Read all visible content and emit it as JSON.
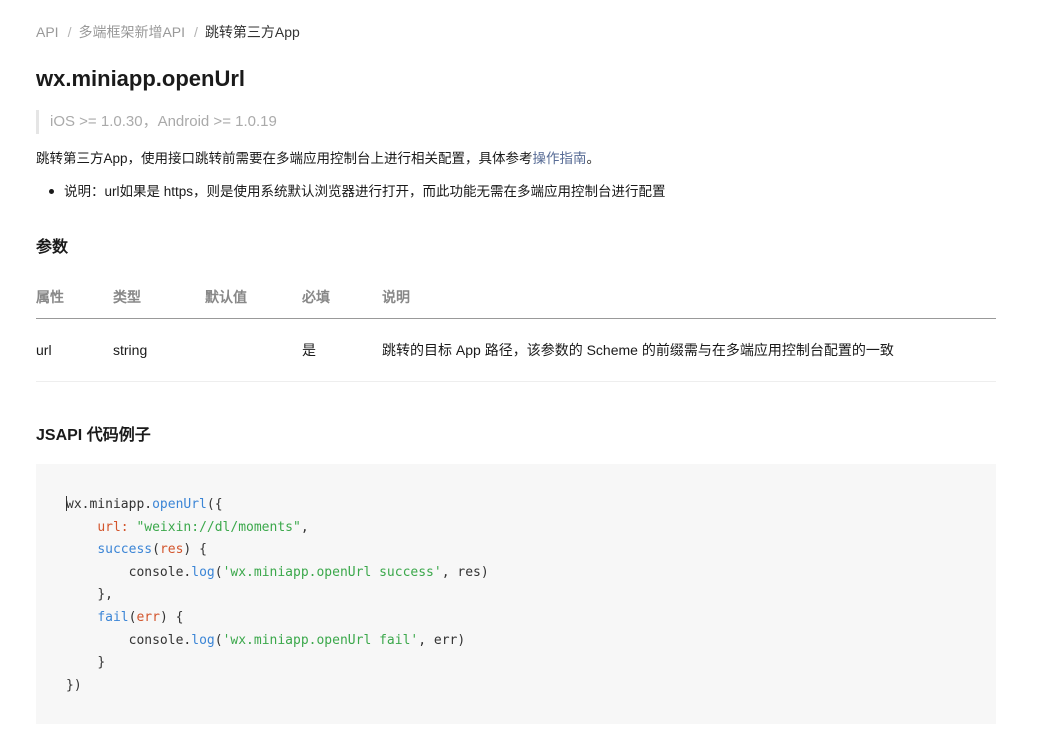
{
  "breadcrumb": {
    "items": [
      "API",
      "多端框架新增API"
    ],
    "separator": "/",
    "current": "跳转第三方App"
  },
  "page_title": "wx.miniapp.openUrl",
  "version_note": "iOS >= 1.0.30，Android >= 1.0.19",
  "description": {
    "text": "跳转第三方App，使用接口跳转前需要在多端应用控制台上进行相关配置，具体参考",
    "link": "操作指南",
    "suffix": "。"
  },
  "note": "说明：url如果是 https，则是使用系统默认浏览器进行打开，而此功能无需在多端应用控制台进行配置",
  "params_section": {
    "heading": "参数",
    "columns": [
      "属性",
      "类型",
      "默认值",
      "必填",
      "说明"
    ],
    "rows": [
      [
        "url",
        "string",
        "",
        "是",
        "跳转的目标 App 路径，该参数的 Scheme 的前缀需与在多端应用控制台配置的一致"
      ]
    ]
  },
  "code_section": {
    "heading": "JSAPI 代码例子",
    "tokens": {
      "obj": "wx.miniapp.",
      "openUrl": "openUrl",
      "open_paren_brace": "({",
      "url_key": "url:",
      "url_value": "\"weixin://dl/moments\"",
      "comma": ",",
      "success": "success",
      "lp": "(",
      "res": "res",
      "rp_brace": ") {",
      "console": "console.",
      "log": "log",
      "success_msg": "'wx.miniapp.openUrl success'",
      "res_tail": ", res)",
      "close_comma": "},",
      "fail": "fail",
      "err": "err",
      "fail_msg": "'wx.miniapp.openUrl fail'",
      "err_tail": ", err)",
      "close_brace": "}",
      "close_all": "})"
    }
  },
  "colors": {
    "link": "#576b95",
    "code_function": "#3b85d6",
    "code_string": "#3ba84b",
    "code_property": "#d3552c",
    "code_background": "#f7f7f7"
  }
}
